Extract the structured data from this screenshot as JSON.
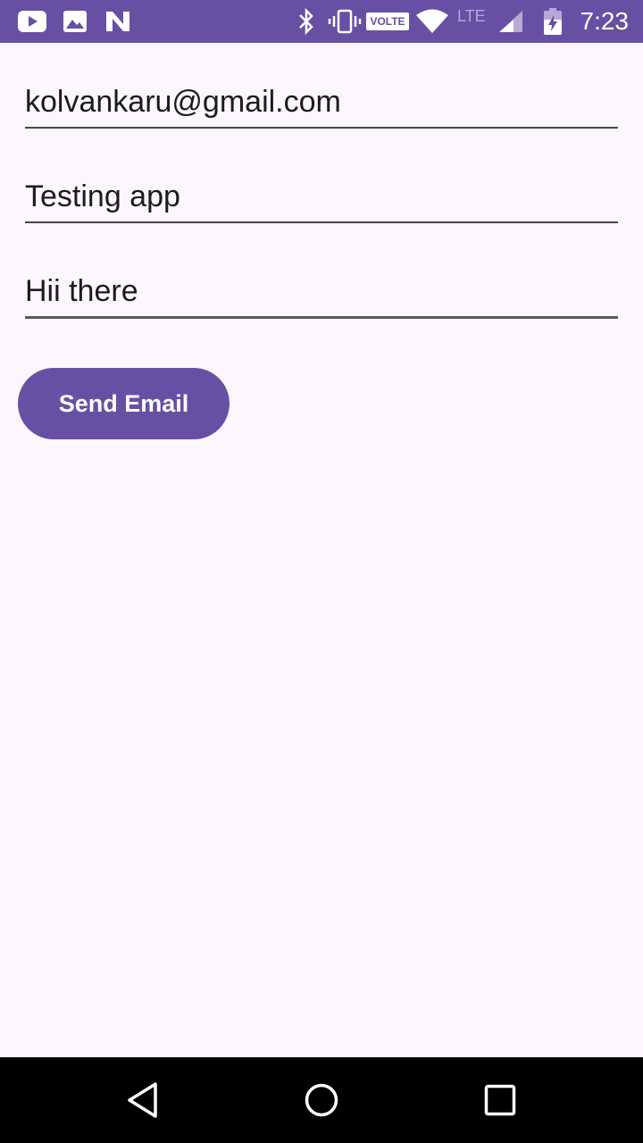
{
  "status_bar": {
    "time": "7:23",
    "volte_badge": "VOLTE",
    "network_type": "LTE",
    "notification_icons": [
      "youtube-icon",
      "image-icon",
      "n-logo-icon"
    ],
    "system_icons": [
      "bluetooth-icon",
      "vibrate-icon",
      "volte-icon",
      "wifi-icon",
      "signal-icon",
      "battery-charging-icon"
    ],
    "background_color": "#6750a4"
  },
  "form": {
    "to_value": "kolvankaru@gmail.com",
    "subject_value": "Testing app",
    "message_value": "Hii there",
    "send_button_label": "Send Email"
  },
  "navigation_bar": {
    "buttons": [
      "back-icon",
      "home-icon",
      "recents-icon"
    ]
  },
  "colors": {
    "accent": "#6750a4",
    "background": "#fcf7fd",
    "text": "#1c1b1f"
  }
}
